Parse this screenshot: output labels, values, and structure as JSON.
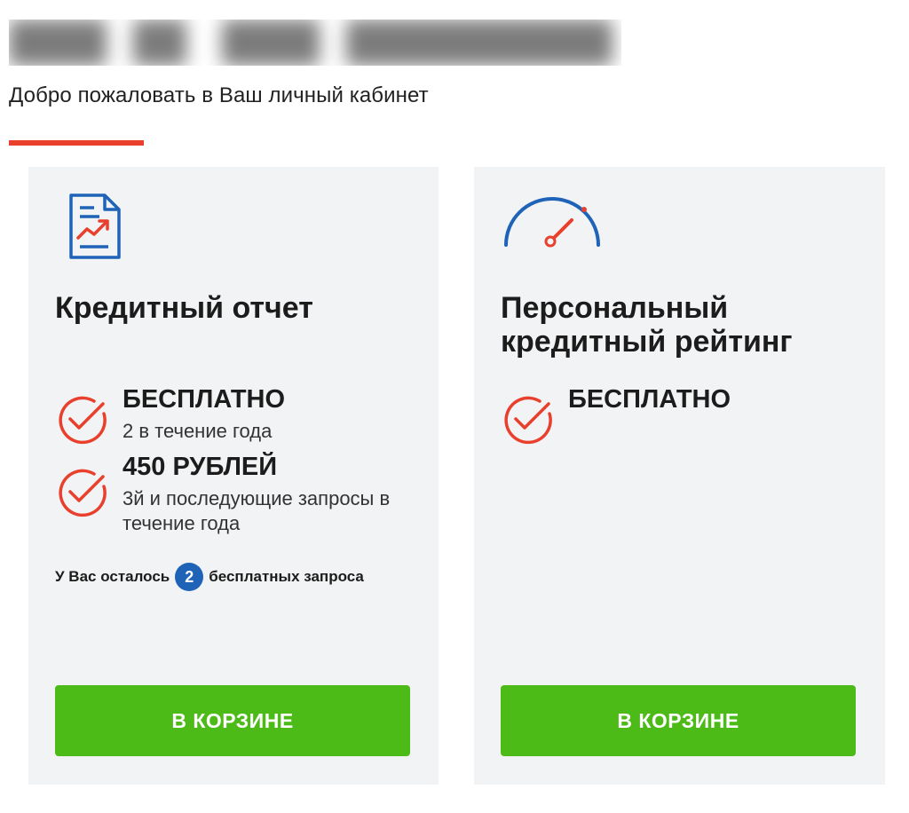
{
  "header": {
    "subtitle": "Добро пожаловать в Ваш личный кабинет"
  },
  "colors": {
    "accent_red": "#e8402d",
    "button_green": "#4cbb17",
    "icon_blue": "#1e63b8",
    "card_background": "#f2f3f4"
  },
  "cards": [
    {
      "icon": "document-chart-icon",
      "title": "Кредитный отчет",
      "features": [
        {
          "price": "БЕСПЛАТНО",
          "description": "2 в течение года"
        },
        {
          "price": "450 РУБЛЕЙ",
          "description": "3й и последующие запросы в течение года"
        }
      ],
      "remaining": {
        "prefix": "У Вас осталось",
        "count": "2",
        "suffix": "бесплатных запроса"
      },
      "button_label": "В КОРЗИНЕ"
    },
    {
      "icon": "speedometer-icon",
      "title": "Персональный кредитный рейтинг",
      "features": [
        {
          "price": "БЕСПЛАТНО"
        }
      ],
      "button_label": "В КОРЗИНЕ"
    }
  ]
}
